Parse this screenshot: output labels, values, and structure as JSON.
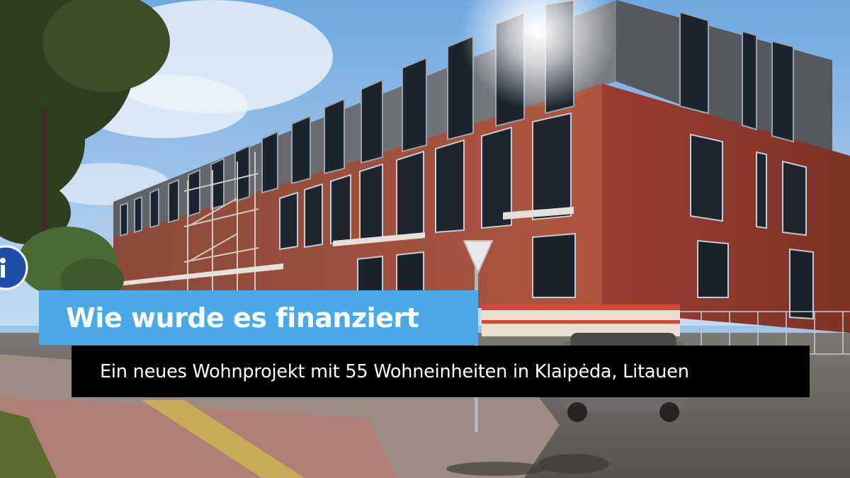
{
  "banner": {
    "title": "Wie wurde es finanziert",
    "subtitle": "Ein neues Wohnprojekt mit 55 Wohneinheiten in Klaipėda, Litauen"
  },
  "colors": {
    "title_background": "#4aa9e6",
    "subtitle_background": "#000000",
    "text": "#ffffff"
  }
}
